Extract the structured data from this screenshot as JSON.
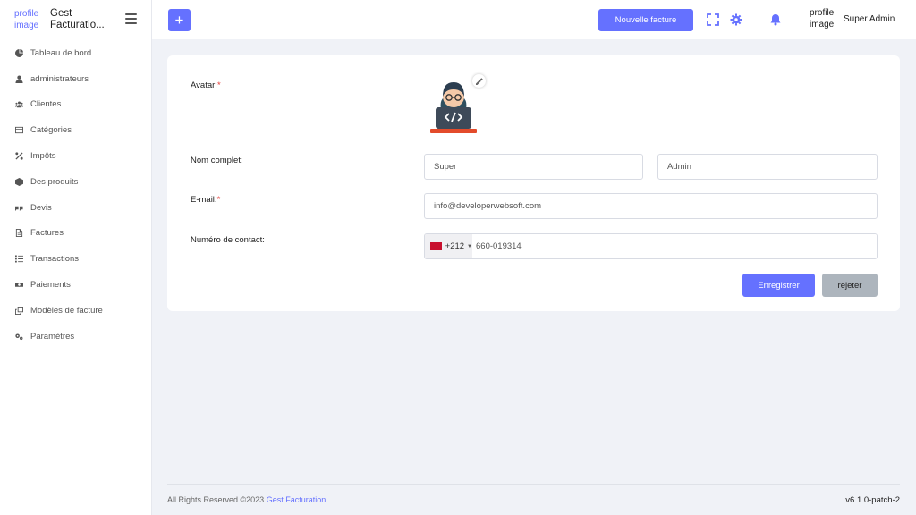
{
  "brand": {
    "image_alt": "profile image",
    "name": "Gest Facturatio..."
  },
  "sidebar": {
    "items": [
      {
        "label": "Tableau de bord",
        "icon": "dashboard-icon"
      },
      {
        "label": "administrateurs",
        "icon": "user-icon"
      },
      {
        "label": "Clientes",
        "icon": "users-icon"
      },
      {
        "label": "Catégories",
        "icon": "list-icon"
      },
      {
        "label": "Impôts",
        "icon": "percent-icon"
      },
      {
        "label": "Des produits",
        "icon": "box-icon"
      },
      {
        "label": "Devis",
        "icon": "quote-icon"
      },
      {
        "label": "Factures",
        "icon": "file-icon"
      },
      {
        "label": "Transactions",
        "icon": "list-ol-icon"
      },
      {
        "label": "Paiements",
        "icon": "money-icon"
      },
      {
        "label": "Modèles de facture",
        "icon": "copy-icon"
      },
      {
        "label": "Paramètres",
        "icon": "cogs-icon"
      }
    ]
  },
  "header": {
    "add_label": "+",
    "new_invoice_label": "Nouvelle facture",
    "profile_image_alt": "profile image",
    "user_name": "Super Admin"
  },
  "form": {
    "avatar_label": "Avatar:",
    "avatar_required": "*",
    "fullname_label": "Nom complet:",
    "first_name": "Super",
    "last_name": "Admin",
    "email_label": "E-mail:",
    "email_required": "*",
    "email_value": "info@developerwebsoft.com",
    "contact_label": "Numéro de contact:",
    "dial_code": "+212",
    "phone_value": "660-019314",
    "save_label": "Enregistrer",
    "reject_label": "rejeter"
  },
  "footer": {
    "copyright": "All Rights Reserved ©2023 ",
    "brand_link": "Gest Facturation",
    "version": "v6.1.0-patch-2"
  },
  "colors": {
    "accent": "#6571ff",
    "secondary": "#adb5bd",
    "flag": "#c8102e"
  }
}
